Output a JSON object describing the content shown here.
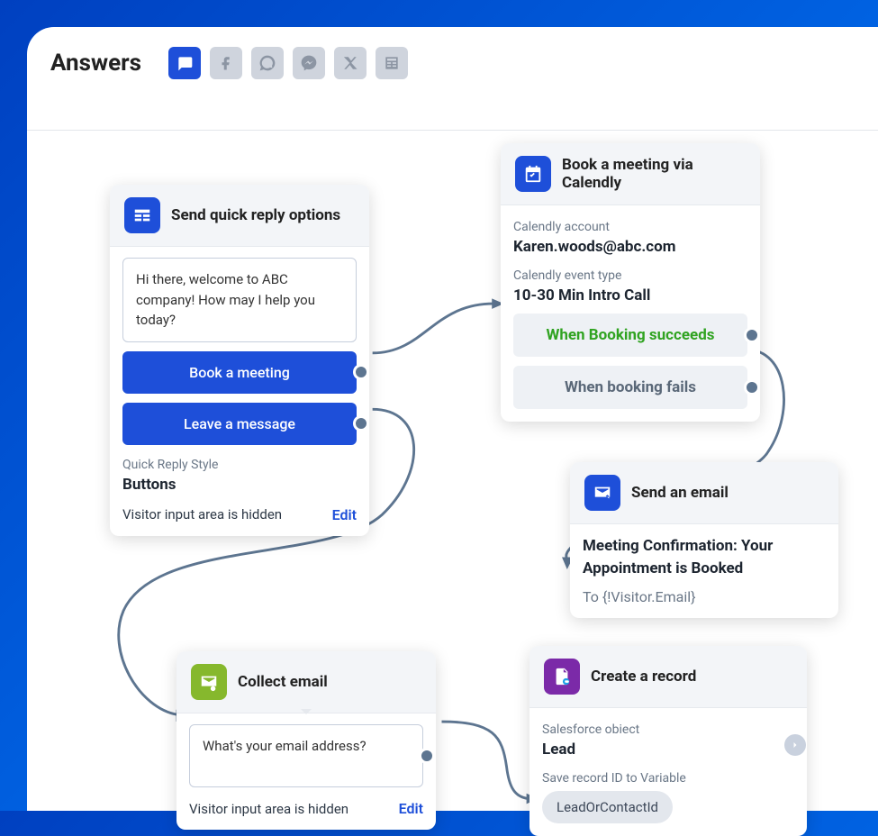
{
  "title": "Answers",
  "channels": [
    "chat",
    "facebook",
    "whatsapp",
    "messenger",
    "x",
    "news"
  ],
  "cards": {
    "quick_reply": {
      "title": "Send quick reply options",
      "message": "Hi there, welcome to ABC company! How may I help you today?",
      "button1": "Book a meeting",
      "button2": "Leave a message",
      "style_label": "Quick Reply Style",
      "style_value": "Buttons",
      "footer": "Visitor input area is hidden",
      "edit": "Edit"
    },
    "calendly": {
      "title": "Book a meeting via Calendly",
      "account_label": "Calendly account",
      "account_value": "Karen.woods@abc.com",
      "event_label": "Calendly event type",
      "event_value": "10-30 Min Intro Call",
      "outcome_success": "When Booking succeeds",
      "outcome_fail": "When booking fails"
    },
    "email": {
      "title": "Send an email",
      "subject": "Meeting Confirmation: Your Appointment is Booked",
      "to": "To {!Visitor.Email}"
    },
    "collect_email": {
      "title": "Collect email",
      "message": "What's your email address?",
      "footer": "Visitor input area is hidden",
      "edit": "Edit"
    },
    "record": {
      "title": "Create a record",
      "object_label": "Salesforce obiect",
      "object_value": "Lead",
      "save_label": "Save record ID to Variable",
      "save_value": "LeadOrContactId"
    }
  }
}
